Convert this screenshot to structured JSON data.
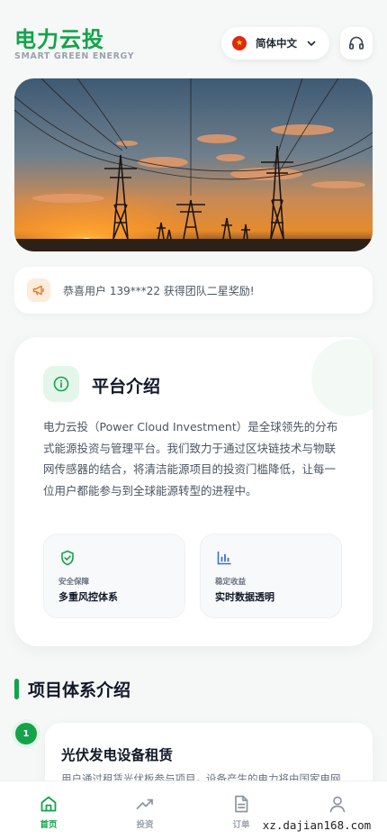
{
  "header": {
    "brand_title": "电力云投",
    "brand_subtitle": "SMART GREEN ENERGY",
    "language_label": "简体中文",
    "flag_icon": "china-flag-icon",
    "support_icon": "headset-icon"
  },
  "notice": {
    "icon": "megaphone-icon",
    "text": "恭喜用户 139***22 获得团队二星奖励!"
  },
  "intro": {
    "icon": "info-icon",
    "title": "平台介绍",
    "body": "电力云投（Power Cloud Investment）是全球领先的分布式能源投资与管理平台。我们致力于通过区块链技术与物联网传感器的结合，将清洁能源项目的投资门槛降低，让每一位用户都能参与到全球能源转型的进程中。",
    "features": [
      {
        "icon": "shield-check-icon",
        "label": "安全保障",
        "value": "多重风控体系"
      },
      {
        "icon": "bar-chart-icon",
        "label": "稳定收益",
        "value": "实时数据透明"
      }
    ]
  },
  "projects": {
    "section_title": "项目体系介绍",
    "items": [
      {
        "index": "1",
        "title": "光伏发电设备租赁",
        "desc": "用户通过租赁光伏板参与项目，设备产生的电力将由国家电网"
      }
    ]
  },
  "tabbar": {
    "items": [
      {
        "label": "首页",
        "icon": "home-icon",
        "active": true
      },
      {
        "label": "投资",
        "icon": "trending-up-icon",
        "active": false
      },
      {
        "label": "订单",
        "icon": "document-icon",
        "active": false
      },
      {
        "label": "我的",
        "icon": "user-icon",
        "active": false
      }
    ]
  },
  "watermark": "xz.dajian168.com",
  "colors": {
    "brand_green": "#14a34a",
    "blue_accent": "#3b6fd4",
    "notice_orange": "#e8792b",
    "background": "#f6f8f7"
  }
}
